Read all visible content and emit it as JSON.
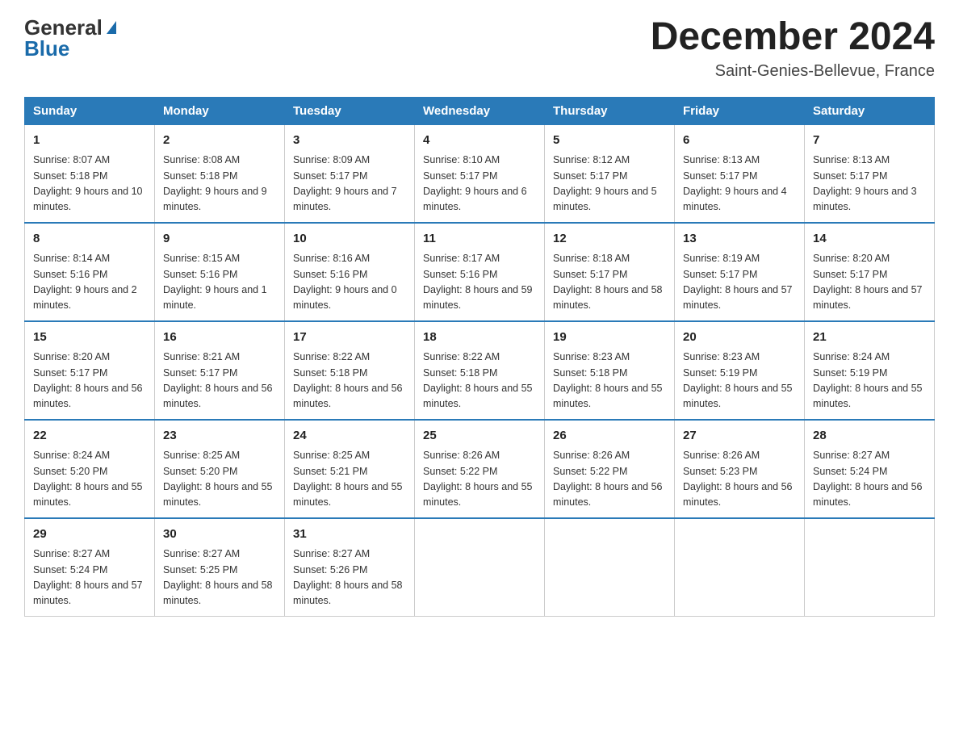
{
  "header": {
    "logo_line1": "General",
    "logo_line2": "Blue",
    "month_title": "December 2024",
    "location": "Saint-Genies-Bellevue, France"
  },
  "columns": [
    "Sunday",
    "Monday",
    "Tuesday",
    "Wednesday",
    "Thursday",
    "Friday",
    "Saturday"
  ],
  "weeks": [
    [
      {
        "day": "1",
        "sunrise": "8:07 AM",
        "sunset": "5:18 PM",
        "daylight": "9 hours and 10 minutes."
      },
      {
        "day": "2",
        "sunrise": "8:08 AM",
        "sunset": "5:18 PM",
        "daylight": "9 hours and 9 minutes."
      },
      {
        "day": "3",
        "sunrise": "8:09 AM",
        "sunset": "5:17 PM",
        "daylight": "9 hours and 7 minutes."
      },
      {
        "day": "4",
        "sunrise": "8:10 AM",
        "sunset": "5:17 PM",
        "daylight": "9 hours and 6 minutes."
      },
      {
        "day": "5",
        "sunrise": "8:12 AM",
        "sunset": "5:17 PM",
        "daylight": "9 hours and 5 minutes."
      },
      {
        "day": "6",
        "sunrise": "8:13 AM",
        "sunset": "5:17 PM",
        "daylight": "9 hours and 4 minutes."
      },
      {
        "day": "7",
        "sunrise": "8:13 AM",
        "sunset": "5:17 PM",
        "daylight": "9 hours and 3 minutes."
      }
    ],
    [
      {
        "day": "8",
        "sunrise": "8:14 AM",
        "sunset": "5:16 PM",
        "daylight": "9 hours and 2 minutes."
      },
      {
        "day": "9",
        "sunrise": "8:15 AM",
        "sunset": "5:16 PM",
        "daylight": "9 hours and 1 minute."
      },
      {
        "day": "10",
        "sunrise": "8:16 AM",
        "sunset": "5:16 PM",
        "daylight": "9 hours and 0 minutes."
      },
      {
        "day": "11",
        "sunrise": "8:17 AM",
        "sunset": "5:16 PM",
        "daylight": "8 hours and 59 minutes."
      },
      {
        "day": "12",
        "sunrise": "8:18 AM",
        "sunset": "5:17 PM",
        "daylight": "8 hours and 58 minutes."
      },
      {
        "day": "13",
        "sunrise": "8:19 AM",
        "sunset": "5:17 PM",
        "daylight": "8 hours and 57 minutes."
      },
      {
        "day": "14",
        "sunrise": "8:20 AM",
        "sunset": "5:17 PM",
        "daylight": "8 hours and 57 minutes."
      }
    ],
    [
      {
        "day": "15",
        "sunrise": "8:20 AM",
        "sunset": "5:17 PM",
        "daylight": "8 hours and 56 minutes."
      },
      {
        "day": "16",
        "sunrise": "8:21 AM",
        "sunset": "5:17 PM",
        "daylight": "8 hours and 56 minutes."
      },
      {
        "day": "17",
        "sunrise": "8:22 AM",
        "sunset": "5:18 PM",
        "daylight": "8 hours and 56 minutes."
      },
      {
        "day": "18",
        "sunrise": "8:22 AM",
        "sunset": "5:18 PM",
        "daylight": "8 hours and 55 minutes."
      },
      {
        "day": "19",
        "sunrise": "8:23 AM",
        "sunset": "5:18 PM",
        "daylight": "8 hours and 55 minutes."
      },
      {
        "day": "20",
        "sunrise": "8:23 AM",
        "sunset": "5:19 PM",
        "daylight": "8 hours and 55 minutes."
      },
      {
        "day": "21",
        "sunrise": "8:24 AM",
        "sunset": "5:19 PM",
        "daylight": "8 hours and 55 minutes."
      }
    ],
    [
      {
        "day": "22",
        "sunrise": "8:24 AM",
        "sunset": "5:20 PM",
        "daylight": "8 hours and 55 minutes."
      },
      {
        "day": "23",
        "sunrise": "8:25 AM",
        "sunset": "5:20 PM",
        "daylight": "8 hours and 55 minutes."
      },
      {
        "day": "24",
        "sunrise": "8:25 AM",
        "sunset": "5:21 PM",
        "daylight": "8 hours and 55 minutes."
      },
      {
        "day": "25",
        "sunrise": "8:26 AM",
        "sunset": "5:22 PM",
        "daylight": "8 hours and 55 minutes."
      },
      {
        "day": "26",
        "sunrise": "8:26 AM",
        "sunset": "5:22 PM",
        "daylight": "8 hours and 56 minutes."
      },
      {
        "day": "27",
        "sunrise": "8:26 AM",
        "sunset": "5:23 PM",
        "daylight": "8 hours and 56 minutes."
      },
      {
        "day": "28",
        "sunrise": "8:27 AM",
        "sunset": "5:24 PM",
        "daylight": "8 hours and 56 minutes."
      }
    ],
    [
      {
        "day": "29",
        "sunrise": "8:27 AM",
        "sunset": "5:24 PM",
        "daylight": "8 hours and 57 minutes."
      },
      {
        "day": "30",
        "sunrise": "8:27 AM",
        "sunset": "5:25 PM",
        "daylight": "8 hours and 58 minutes."
      },
      {
        "day": "31",
        "sunrise": "8:27 AM",
        "sunset": "5:26 PM",
        "daylight": "8 hours and 58 minutes."
      },
      null,
      null,
      null,
      null
    ]
  ]
}
